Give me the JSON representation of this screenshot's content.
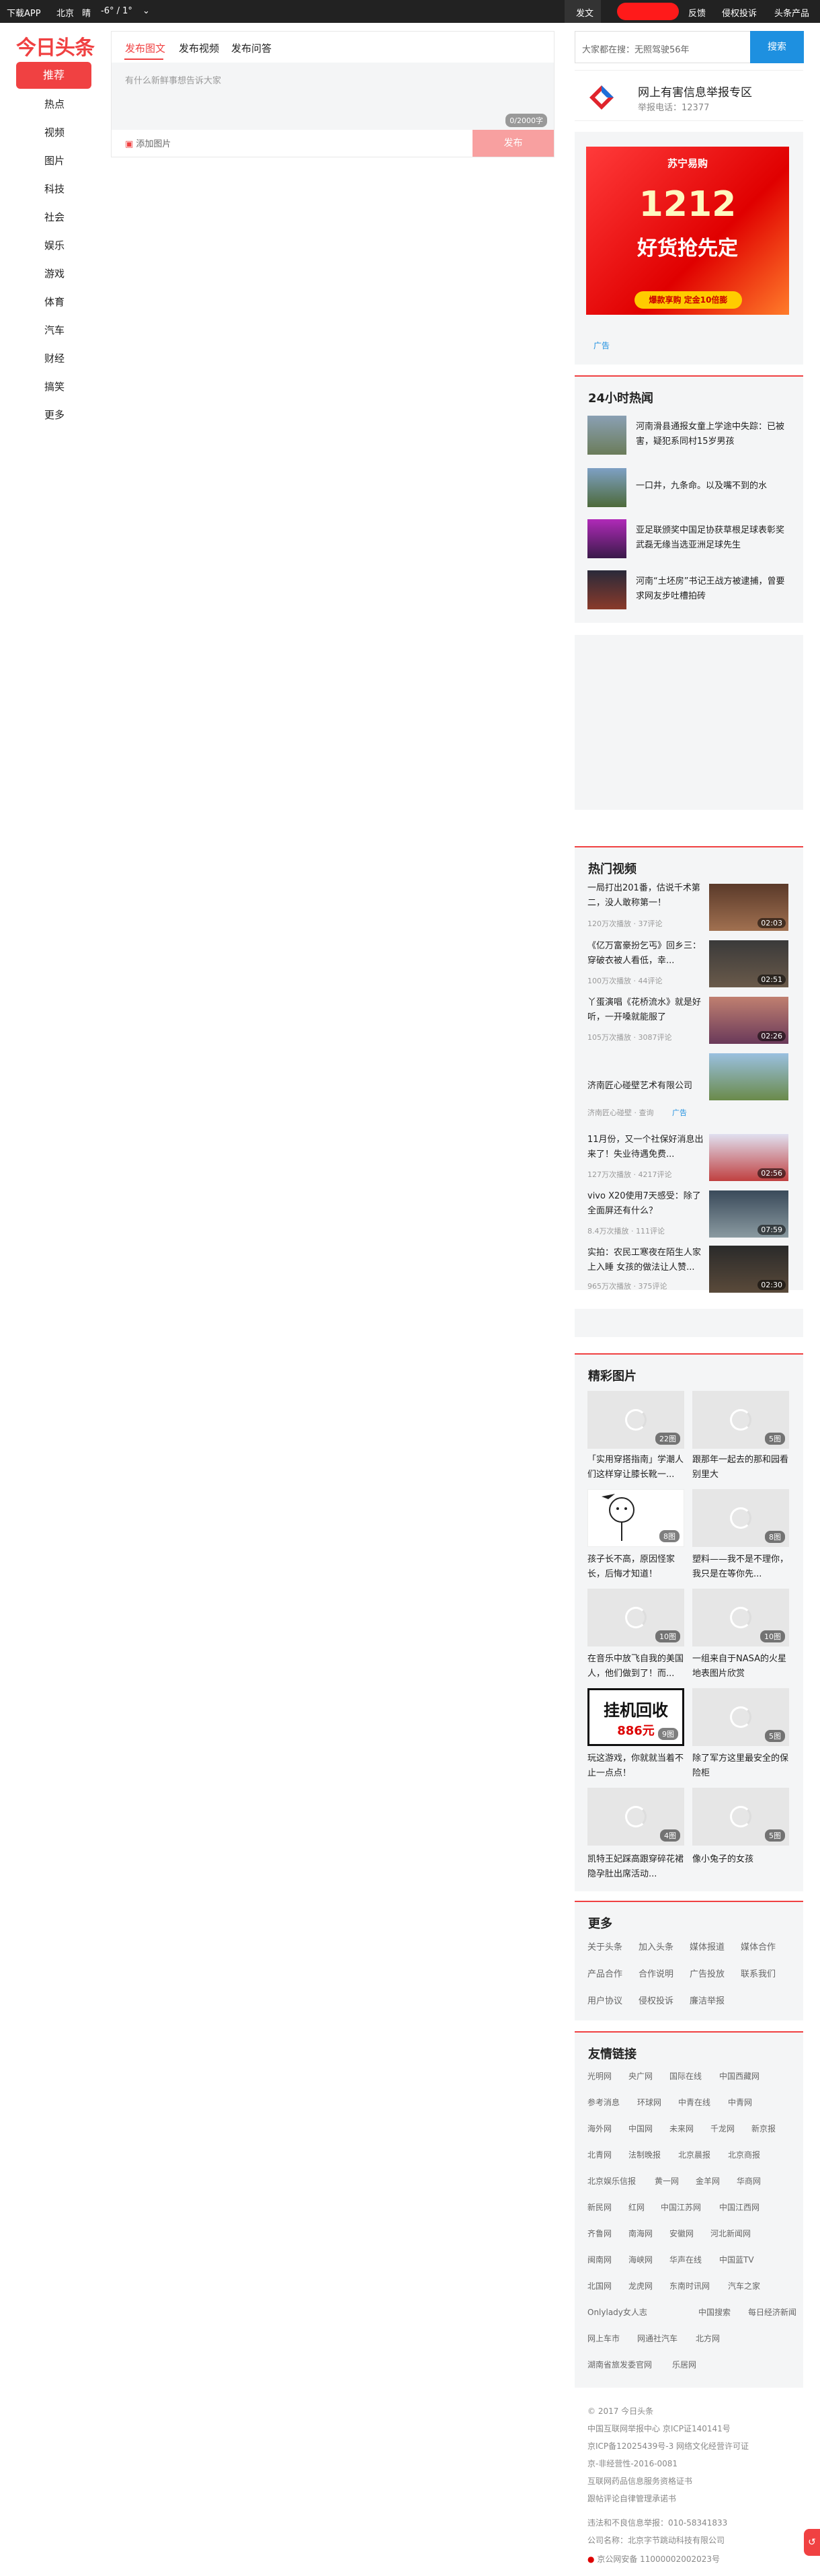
{
  "topbar": {
    "download": "下载APP",
    "city": "北京",
    "weather": "晴",
    "temp": "-6° / 1°",
    "publish": "发文",
    "feedback": "反馈",
    "rights": "侵权投诉",
    "products": "头条产品"
  },
  "logo": "今日头条",
  "nav": [
    "推荐",
    "热点",
    "视频",
    "图片",
    "科技",
    "社会",
    "娱乐",
    "游戏",
    "体育",
    "汽车",
    "财经",
    "搞笑",
    "更多"
  ],
  "publish": {
    "tabs": [
      "发布图文",
      "发布视频",
      "发布问答"
    ],
    "placeholder": "有什么新鲜事想告诉大家",
    "count": "0/2000字",
    "add_image": "添加图片",
    "submit": "发布"
  },
  "search": {
    "placeholder": "大家都在搜：无照驾驶56年",
    "button": "搜索"
  },
  "report": {
    "title": "网上有害信息举报专区",
    "tel": "举报电话：12377"
  },
  "ad": {
    "brand": "苏宁易购",
    "big": "1212",
    "sub": "好货抢先定",
    "pill": "爆款享购 定金10倍膨",
    "tag": "广告"
  },
  "hot24": {
    "title": "24小时热闻",
    "items": [
      "河南滑县通报女童上学途中失踪：已被害，疑犯系同村15岁男孩",
      "一口井，九条命。以及嘴不到的水",
      "亚足联颁奖中国足协获草根足球表彰奖 武磊无缘当选亚洲足球先生",
      "河南“土坯房”书记王战方被逮捕，曾要求网友步吐槽拍砖"
    ]
  },
  "hotvideo": {
    "title": "热门视频",
    "items": [
      {
        "title": "一局打出201番，估说千术第二，没人敢称第一！",
        "meta": "120万次播放 · 37评论",
        "dur": "02:03"
      },
      {
        "title": "《亿万富豪扮乞丐》回乡三：穿破衣被人看低，幸...",
        "meta": "100万次播放 · 44评论",
        "dur": "02:51"
      },
      {
        "title": "丫蛋演唱《花桥流水》就是好听，一开嗓就能服了",
        "meta": "105万次播放 · 3087评论",
        "dur": "02:26"
      },
      {
        "title": "济南匠心碰壁艺术有限公司",
        "meta": "济南匠心碰壁 · 查询",
        "ad": "广告",
        "dur": ""
      },
      {
        "title": "11月份，又一个社保好消息出来了！失业待遇免费...",
        "meta": "127万次播放 · 4217评论",
        "dur": "02:56"
      },
      {
        "title": "vivo X20使用7天感受：除了全面屏还有什么？",
        "meta": "8.4万次播放 · 111评论",
        "dur": "07:59"
      },
      {
        "title": "实拍：农民工寒夜在陌生人家上入睡 女孩的做法让人赞...",
        "meta": "965万次播放 · 375评论",
        "dur": "02:30"
      }
    ]
  },
  "photos": {
    "title": "精彩图片",
    "items": [
      {
        "title": "「实用穿搭指南」学潮人们这样穿让膝长靴一...",
        "count": "22图"
      },
      {
        "title": "跟那年一起去的那和园看别里大",
        "count": "5图"
      },
      {
        "title": "孩子长不高，原因怪家长，后悔才知道！",
        "count": "8图"
      },
      {
        "title": "塑料——我不是不理你，我只是在等你先...",
        "count": "8图"
      },
      {
        "title": "在音乐中放飞自我的美国人，他们做到了！而...",
        "count": "10图"
      },
      {
        "title": "一组来自于NASA的火星地表图片欣赏",
        "count": "10图"
      },
      {
        "title": "玩这游戏，你就就当着不止一点点！",
        "count": "9图"
      },
      {
        "title": "除了军方这里最安全的保险柜",
        "count": "5图"
      },
      {
        "title": "凯特王妃踩高跟穿碎花裙隐孕肚出席活动...",
        "count": "4图"
      },
      {
        "title": "像小兔子的女孩",
        "count": "5图"
      }
    ],
    "ad_text": "挂机回收",
    "ad_price": "886元"
  },
  "more": {
    "title": "更多",
    "links": [
      "关于头条",
      "加入头条",
      "媒体报道",
      "媒体合作",
      "产品合作",
      "合作说明",
      "广告投放",
      "联系我们",
      "用户协议",
      "侵权投诉",
      "廉洁举报"
    ]
  },
  "friends": {
    "title": "友情链接",
    "links": [
      [
        "光明网",
        "央广网",
        "国际在线",
        "中国西藏网"
      ],
      [
        "参考消息",
        "环球网",
        "中青在线",
        "中青网"
      ],
      [
        "海外网",
        "中国网",
        "未来网",
        "千龙网",
        "新京报"
      ],
      [
        "北青网",
        "法制晚报",
        "北京晨报",
        "北京商报"
      ],
      [
        "北京娱乐信报",
        "黄一网",
        "金羊网",
        "华商网"
      ],
      [
        "新民网",
        "红网",
        "中国江苏网",
        "中国江西网"
      ],
      [
        "齐鲁网",
        "南海网",
        "安徽网",
        "河北新闻网"
      ],
      [
        "闽南网",
        "海峡网",
        "华声在线",
        "中国蓝TV"
      ],
      [
        "北国网",
        "龙虎网",
        "东南时讯网",
        "汽车之家"
      ],
      [
        "Onlylady女人志",
        "中国搜索",
        "每日经济新闻"
      ],
      [
        "网上车市",
        "网通社汽车",
        "北方网"
      ],
      [
        "湖南省旅发委官网",
        "乐居网"
      ]
    ]
  },
  "footer": [
    "© 2017 今日头条",
    "中国互联网举报中心 京ICP证140141号",
    "京ICP备12025439号-3 网络文化经营许可证",
    "京-非经营性-2016-0081",
    "互联网药品信息服务资格证书",
    "跟帖评论自律管理承诺书",
    "违法和不良信息举报：010-58341833",
    "公司名称：北京字节跳动科技有限公司",
    "京公网安备 11000002002023号"
  ]
}
